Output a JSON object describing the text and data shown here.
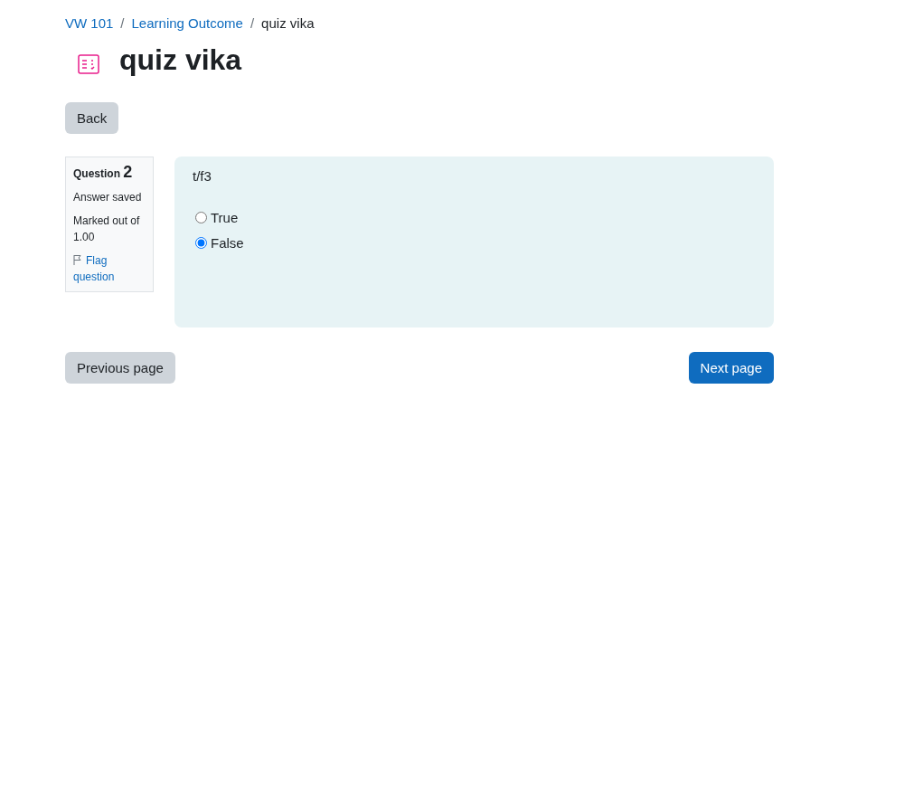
{
  "breadcrumb": [
    {
      "label": "VW 101",
      "link": true
    },
    {
      "label": "Learning Outcome",
      "link": true
    },
    {
      "label": "quiz vika",
      "link": false
    }
  ],
  "breadcrumb_separator": "/",
  "title": "quiz vika",
  "back_button": "Back",
  "question_info": {
    "label": "Question",
    "number": "2",
    "state": "Answer saved",
    "marks": "Marked out of 1.00",
    "flag": "Flag question"
  },
  "question": {
    "text": "t/f3",
    "options": [
      {
        "label": "True",
        "selected": false
      },
      {
        "label": "False",
        "selected": true
      }
    ]
  },
  "nav": {
    "previous": "Previous page",
    "next": "Next page"
  }
}
